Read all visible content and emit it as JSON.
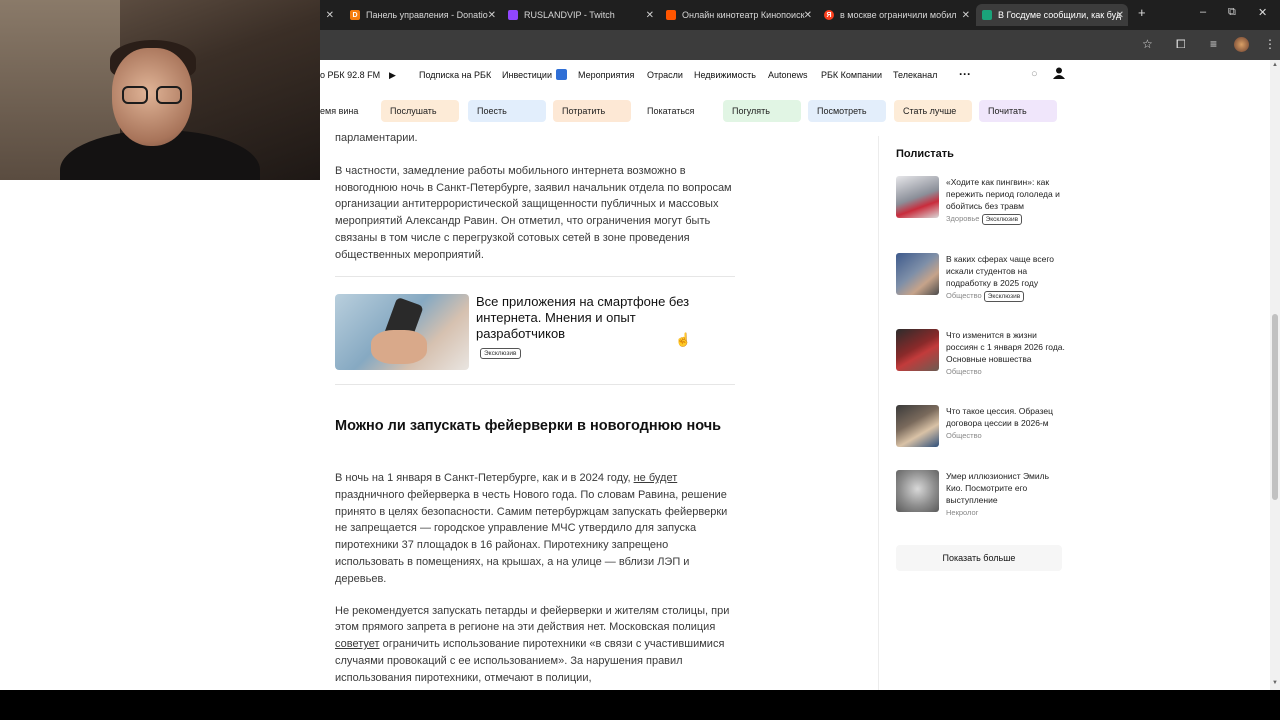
{
  "browser": {
    "tabs": [
      {
        "label": "Панель управления - Donatio",
        "icon": "donationalerts-icon",
        "color": "#f57d0f"
      },
      {
        "label": "RUSLANDVIP - Twitch",
        "icon": "twitch-icon",
        "color": "#9146ff"
      },
      {
        "label": "Онлайн кинотеатр Кинопоиск",
        "icon": "kinopoisk-icon",
        "color": "#ff5500"
      },
      {
        "label": "в москве ограничили мобил",
        "icon": "yandex-icon",
        "color": "#fc3f1d"
      },
      {
        "label": "В Госдуме сообщили, как буд",
        "icon": "rbc-icon",
        "color": "#1aa37a"
      }
    ],
    "new_tab": "+",
    "window_controls": {
      "minimize": "–",
      "maximize": "⧉",
      "close": "✕"
    }
  },
  "site_nav": {
    "radio": "о РБК 92.8 FM",
    "items": [
      "Подписка на РБК",
      "Инвестиции",
      "Мероприятия",
      "Отрасли",
      "Недвижимость",
      "Autonews",
      "РБК Компании",
      "Телеканал"
    ],
    "more": "···"
  },
  "chips": [
    {
      "label": "емя вина",
      "color": "#ffffff"
    },
    {
      "label": "Послушать",
      "color": "#fdebd7"
    },
    {
      "label": "Поесть",
      "color": "#e2eefc"
    },
    {
      "label": "Потратить",
      "color": "#fde8d5"
    },
    {
      "label": "Покататься",
      "color": "#ffffff"
    },
    {
      "label": "Погулять",
      "color": "#e1f5e4"
    },
    {
      "label": "Посмотреть",
      "color": "#e3eefb"
    },
    {
      "label": "Стать лучше",
      "color": "#fdecd8"
    },
    {
      "label": "Почитать",
      "color": "#f0e6fb"
    }
  ],
  "article": {
    "p0": "парламентарии.",
    "p1": "В частности, замедление работы мобильного интернета возможно в новогоднюю ночь в Санкт-Петербурге, заявил начальник отдела по вопросам организации антитеррористической защищенности публичных и массовых мероприятий Александр Равин. Он отметил, что ограничения могут быть связаны в том числе с перегрузкой сотовых сетей в зоне проведения общественных мероприятий.",
    "promo_title": "Все приложения на смартфоне без интернета. Мнения и опыт разработчиков",
    "promo_badge": "Эксклюзив",
    "h2": "Можно ли запускать фейерверки в новогоднюю ночь",
    "p2_a": "В ночь на 1 января в Санкт-Петербурге, как и в 2024 году, ",
    "p2_link": "не будет",
    "p2_b": " праздничного фейерверка в честь Нового года. По словам Равина, решение принято в целях безопасности. Самим петербуржцам запускать фейерверки не запрещается — городское управление МЧС утвердило для запуска пиротехники 37 площадок в 16 районах. Пиротехнику запрещено использовать в помещениях, на крышах, а на улице — вблизи ЛЭП и деревьев.",
    "p3_a": "Не рекомендуется запускать петарды и фейерверки и жителям столицы, при этом прямого запрета в регионе на эти действия нет. Московская полиция ",
    "p3_link": "советует",
    "p3_b": " ограничить использование пиротехники «в связи с участившимися случаями провокаций с ее использованием». За нарушения правил использования пиротехники, отмечают в полиции,"
  },
  "sidebar": {
    "title": "Полистать",
    "items": [
      {
        "text": "«Ходите как пингвин»: как пережить период гололеда и обойтись без травм",
        "category": "Здоровье",
        "badge": "Эксклюзив"
      },
      {
        "text": "В каких сферах чаще всего искали студентов на подработку в 2025 году",
        "category": "Общество",
        "badge": "Эксклюзив"
      },
      {
        "text": "Что изменится в жизни россиян с 1 января 2026 года. Основные новшества",
        "category": "Общество",
        "badge": ""
      },
      {
        "text": "Что такое цессия. Образец договора цессии в 2026-м",
        "category": "Общество",
        "badge": ""
      },
      {
        "text": "Умер иллюзионист Эмиль Кио. Посмотрите его выступление",
        "category": "Некролог",
        "badge": ""
      }
    ],
    "more": "Показать больше"
  }
}
